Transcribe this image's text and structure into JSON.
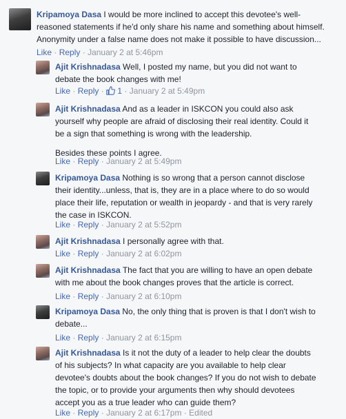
{
  "labels": {
    "like": "Like",
    "reply": "Reply",
    "dot": "·"
  },
  "main_comment": {
    "author": "Kripamoya Dasa",
    "lines": [
      "I would be more inclined to accept this devotee's well-",
      "reasoned statements if he'd only share his name and something about himself.",
      "Anonymity under a false name does not make it possible to have discussion..."
    ],
    "time": "January 2 at 5:46pm"
  },
  "replies": [
    {
      "author": "Ajit Krishnadasa",
      "lines": [
        "Well, I posted my name, but you did not want to",
        "debate the book changes with me!"
      ],
      "likes": "1",
      "time": "January 2 at 5:49pm"
    },
    {
      "author": "Ajit Krishnadasa",
      "lines": [
        "And as a leader in ISKCON you could also ask",
        "yourself why people are afraid of disclosing their real identity. Could it",
        "be a sign that something is wrong with the leadership."
      ],
      "lines2": [
        "Besides these points I agree."
      ],
      "time": "January 2 at 5:49pm"
    },
    {
      "author": "Kripamoya Dasa",
      "lines": [
        "Nothing is so wrong that a person cannot disclose",
        "their identity...unless, that is, they are in a place where to do so would",
        "place their life, reputation or wealth in jeopardy - and that is very rarely",
        "the case in ISKCON."
      ],
      "time": "January 2 at 5:52pm"
    },
    {
      "author": "Ajit Krishnadasa",
      "lines": [
        "I personally agree with that."
      ],
      "time": "January 2 at 6:02pm"
    },
    {
      "author": "Ajit Krishnadasa",
      "lines": [
        "The fact that you are willing to have an open debate",
        "with me about the book changes proves that the article is correct."
      ],
      "time": "January 2 at 6:10pm"
    },
    {
      "author": "Kripamoya Dasa",
      "lines": [
        "No, the only thing that is proven is that I don't wish to",
        "debate..."
      ],
      "time": "January 2 at 6:15pm"
    },
    {
      "author": "Ajit Krishnadasa",
      "lines": [
        "Is it not the duty of a leader to help clear the doubts",
        "of his subjects? In what capacity are you available to help clear",
        "devotee's doubts about the book changes? If you do not wish to debate",
        "the topic, or to provide your arguments then why should devotees",
        "accept you as a true leader who can guide them?"
      ],
      "time": "January 2 at 6:17pm",
      "edited": "Edited"
    }
  ]
}
